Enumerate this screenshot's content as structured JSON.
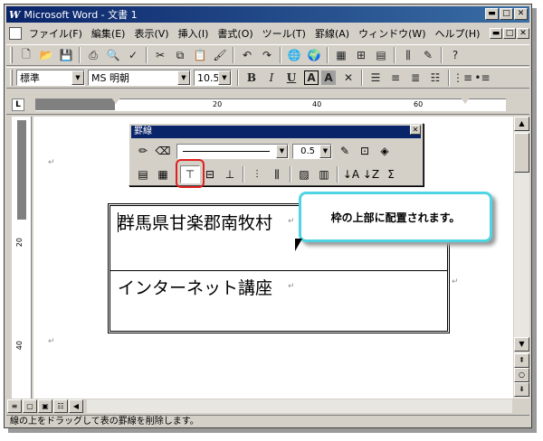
{
  "window": {
    "logo": "W",
    "title": "Microsoft Word - 文書 1",
    "min": "▬",
    "max": "□",
    "close": "✕"
  },
  "menu": {
    "items": [
      "ファイル(F)",
      "編集(E)",
      "表示(V)",
      "挿入(I)",
      "書式(O)",
      "ツール(T)",
      "罫線(A)",
      "ウィンドウ(W)",
      "ヘルプ(H)"
    ]
  },
  "formatting": {
    "style": "標準",
    "font": "MS 明朝",
    "size": "10.5",
    "bold": "B",
    "italic": "I",
    "underline": "U",
    "border_a": "A",
    "shade_a": "A"
  },
  "ruler": {
    "corner": "L",
    "labels": [
      "20",
      "40",
      "60"
    ],
    "vlabels": [
      "20",
      "40"
    ]
  },
  "table_toolbar": {
    "title": "罫線",
    "close": "✕",
    "line_weight": "0.5",
    "sigma": "Σ"
  },
  "document": {
    "cell1": "群馬県甘楽郡南牧村",
    "cell2": "インターネット講座",
    "para_mark": "↵"
  },
  "callout": {
    "text": "枠の上部に配置されます。"
  },
  "status": {
    "text": "線の上をドラッグして表の罫線を削除します。"
  },
  "colors": {
    "titlebar": "#0a246a",
    "callout_border": "#4fd4e4",
    "highlight_ring": "#e02020"
  }
}
